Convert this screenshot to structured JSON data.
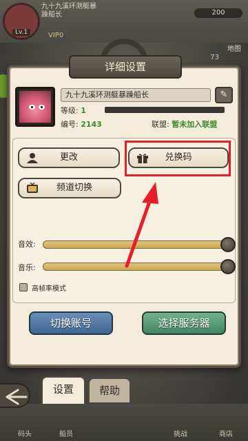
{
  "background": {
    "player_name": "九十九溪环测艇暴躁船长",
    "level": "Lv.1",
    "vip": "VIP0",
    "map_label": "地图",
    "resource_value": "200",
    "number_value": "73",
    "nav_items": [
      "码头",
      "船员",
      "挑战",
      "商店"
    ]
  },
  "dialog": {
    "title": "详细设置",
    "profile": {
      "name": "九十九溪环测艇暴躁船长",
      "level_label": "等级:",
      "level_value": "1",
      "id_label": "编号:",
      "id_value": "2143",
      "alliance_label": "联盟:",
      "alliance_value": "暂未加入联盟"
    },
    "buttons": {
      "change": "更改",
      "redeem_code": "兑换码",
      "channel_switch": "频道切换"
    },
    "sound": {
      "effects_label": "音效:",
      "music_label": "音乐:",
      "effects_level": 1.0,
      "music_level": 1.0
    },
    "high_fps": {
      "label": "高帧率模式",
      "checked": false
    },
    "switch_account": "切换账号",
    "select_server": "选择服务器"
  },
  "tabs": {
    "settings": "设置",
    "help": "帮助"
  },
  "colors": {
    "highlight": "#e5202a",
    "value_green": "#3c8a32"
  },
  "icons": [
    "back-arrow-icon",
    "quill-edit-icon",
    "person-icon",
    "gift-icon",
    "tv-icon"
  ]
}
